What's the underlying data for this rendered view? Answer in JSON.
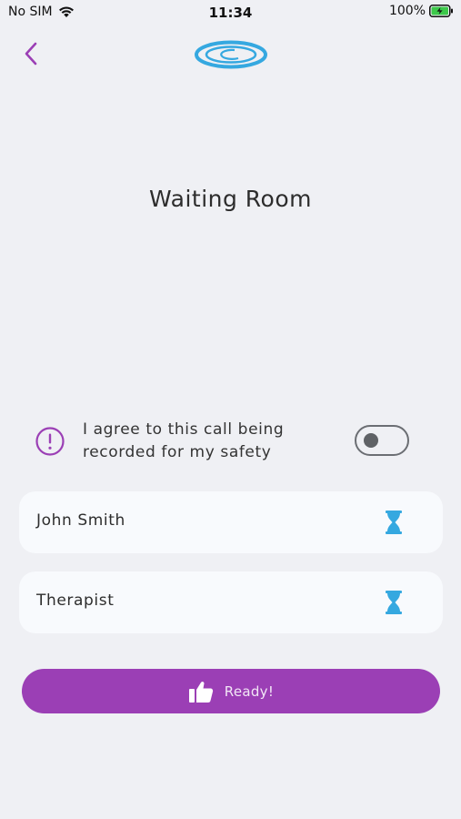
{
  "status_bar": {
    "carrier": "No SIM",
    "time": "11:34",
    "battery": "100%"
  },
  "header": {
    "back_icon": "chevron-left-icon",
    "logo": "ring-logo"
  },
  "page": {
    "title": "Waiting Room"
  },
  "consent": {
    "icon": "exclamation-circle-icon",
    "text": "I agree to this call being recorded for my safety",
    "toggle_on": false
  },
  "participants": [
    {
      "name": "John Smith",
      "status_icon": "hourglass-icon"
    },
    {
      "name": "Therapist",
      "status_icon": "hourglass-icon"
    }
  ],
  "ready_button": {
    "label": "Ready!",
    "icon": "thumbs-up-icon"
  },
  "colors": {
    "background": "#eff0f4",
    "accent_purple": "#9b3fb5",
    "hourglass_blue": "#35a8e0",
    "card": "#f8fafd"
  }
}
